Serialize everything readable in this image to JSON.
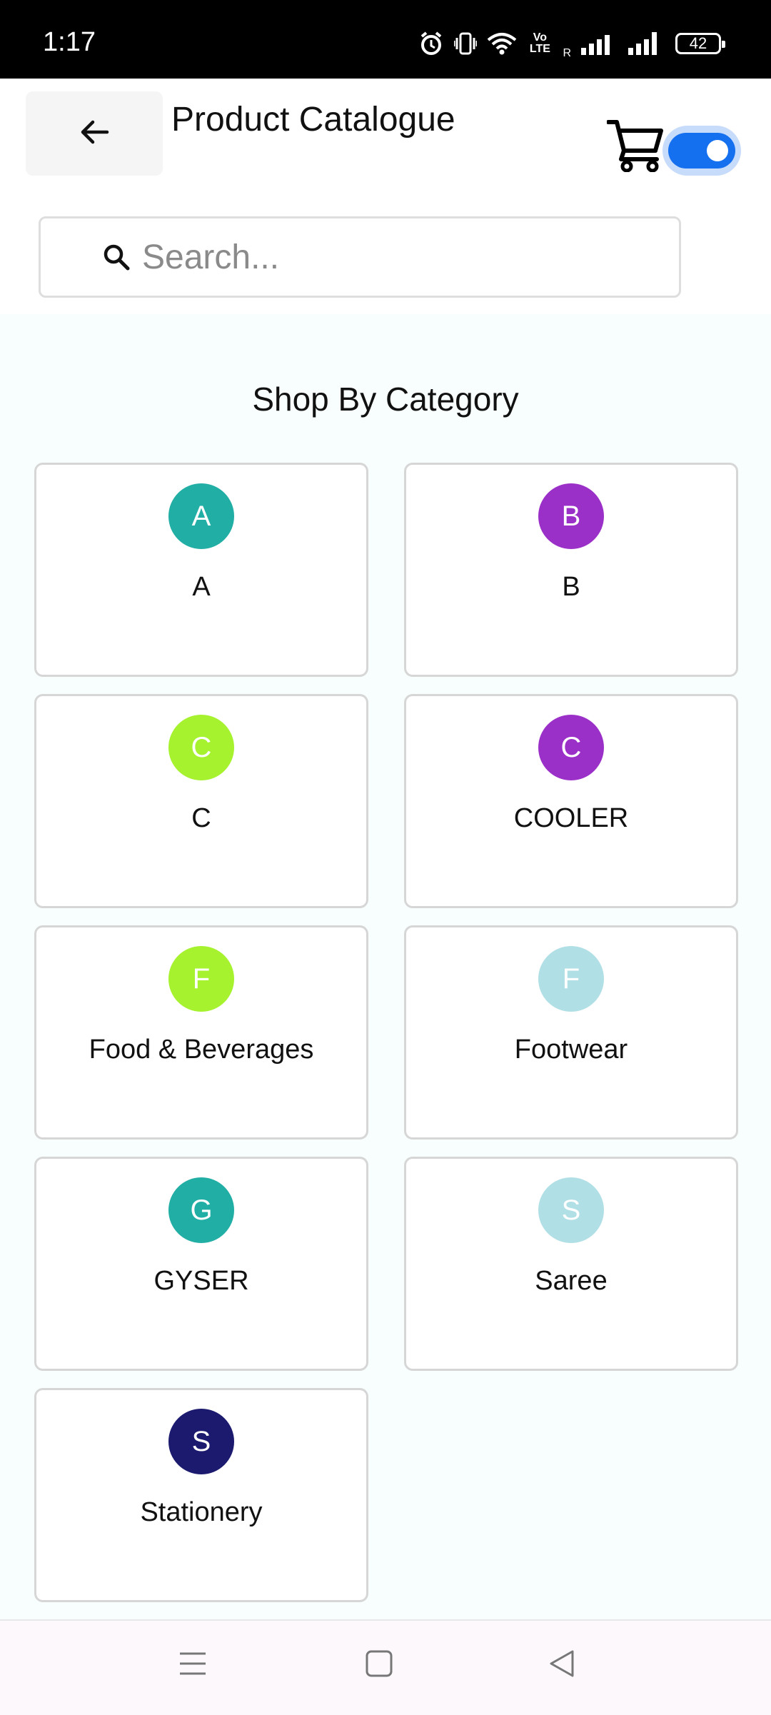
{
  "status_bar": {
    "time": "1:17",
    "network_label": "Vo LTE",
    "roaming": "R",
    "battery": "42",
    "icons": [
      "alarm-icon",
      "vibrate-icon",
      "wifi-icon",
      "signal-icon",
      "signal-icon",
      "battery-icon"
    ]
  },
  "header": {
    "title": "Product Catalogue",
    "back_icon": "arrow-left-icon",
    "cart_icon": "cart-icon",
    "toggle_on": true
  },
  "search": {
    "placeholder": "Search...",
    "value": ""
  },
  "main": {
    "section_title": "Shop By Category",
    "categories": [
      {
        "initial": "A",
        "label": "A",
        "color": "#21aea5"
      },
      {
        "initial": "B",
        "label": "B",
        "color": "#9b30c8"
      },
      {
        "initial": "C",
        "label": "C",
        "color": "#a6f22f"
      },
      {
        "initial": "C",
        "label": "COOLER",
        "color": "#9b30c8"
      },
      {
        "initial": "F",
        "label": "Food & Beverages",
        "color": "#a6f22f"
      },
      {
        "initial": "F",
        "label": "Footwear",
        "color": "#b1dfe6"
      },
      {
        "initial": "G",
        "label": "GYSER",
        "color": "#21aea5"
      },
      {
        "initial": "S",
        "label": "Saree",
        "color": "#b1dfe6"
      },
      {
        "initial": "S",
        "label": "Stationery",
        "color": "#1b1a6e"
      }
    ]
  },
  "nav_bar": {
    "icons": [
      "menu-icon",
      "home-icon",
      "back-icon"
    ]
  },
  "colors": {
    "accent": "#1570ef",
    "background": "#f8fefe"
  }
}
